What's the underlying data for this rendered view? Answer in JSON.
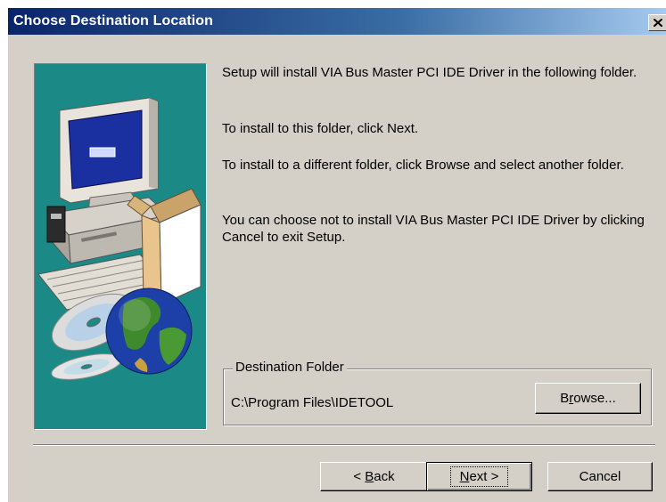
{
  "window": {
    "title": "Choose Destination Location",
    "close_icon": "close-icon"
  },
  "messages": {
    "line1": "Setup will install VIA Bus Master PCI IDE Driver in the following folder.",
    "line2": "To install to this folder, click Next.",
    "line3": "To install to a different folder, click Browse and select another folder.",
    "line4": "You can choose not to install VIA Bus Master PCI IDE Driver by clicking Cancel to exit Setup."
  },
  "destination": {
    "group_label": "Destination Folder",
    "path": "C:\\Program Files\\IDETOOL",
    "browse_pre": "B",
    "browse_key": "r",
    "browse_post": "owse..."
  },
  "buttons": {
    "back_pre": "< ",
    "back_key": "B",
    "back_post": "ack",
    "next_key": "N",
    "next_post": "ext >",
    "cancel": "Cancel"
  },
  "graphic": {
    "icons": [
      "computer-icon",
      "box-icon",
      "cd-icon",
      "globe-icon"
    ],
    "background": "#1b8a87"
  },
  "colors": {
    "titlebar_start": "#0a246a",
    "titlebar_end": "#a6caf0",
    "dialog_face": "#d4d0c8"
  }
}
